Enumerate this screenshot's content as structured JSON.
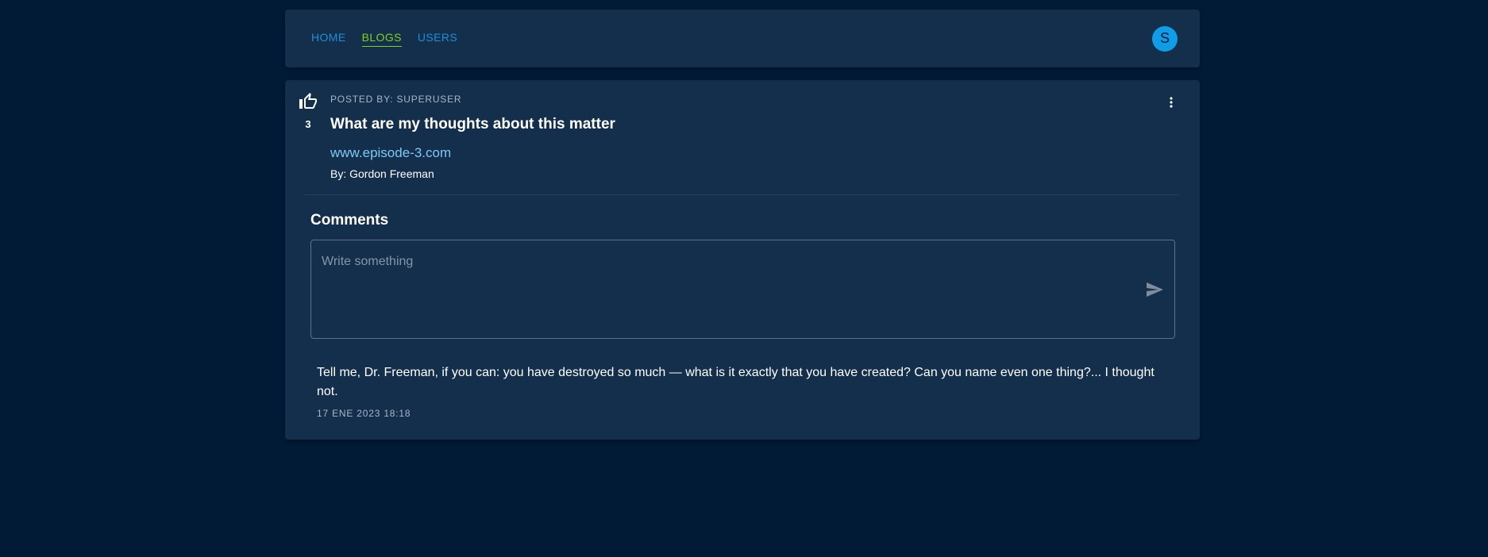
{
  "nav": {
    "links": [
      {
        "label": "HOME",
        "active": false
      },
      {
        "label": "BLOGS",
        "active": true
      },
      {
        "label": "USERS",
        "active": false
      }
    ],
    "avatar_initial": "S"
  },
  "post": {
    "posted_by": "POSTED BY: SUPERUSER",
    "vote_count": "3",
    "title": "What are my thoughts about this matter",
    "url": "www.episode-3.com",
    "author": "By: Gordon Freeman",
    "like_icon": "thumb-up-icon",
    "more_icon": "more-vert-icon"
  },
  "comments": {
    "title": "Comments",
    "input_placeholder": "Write something",
    "send_icon": "send-icon",
    "items": [
      {
        "text": "Tell me, Dr. Freeman, if you can: you have destroyed so much — what is it exactly that you have created? Can you name even one thing?... I thought not.",
        "date": "17 ENE 2023 18:18"
      }
    ]
  },
  "colors": {
    "background": "#011a35",
    "surface": "#132f4c",
    "nav_link": "#1e8fd6",
    "nav_active": "#7ed321",
    "avatar": "#0f9de8",
    "link": "#7ec8f4"
  }
}
